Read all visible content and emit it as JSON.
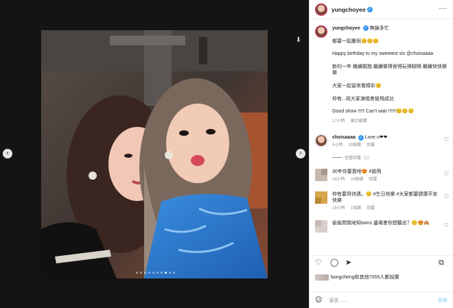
{
  "viewer": {
    "prev_icon": "chevron-left-icon",
    "next_icon": "chevron-right-icon",
    "download_icon": "download-icon",
    "prev_glyph": "‹",
    "next_glyph": "›",
    "download_glyph": "⬇"
  },
  "header": {
    "username": "yungchoyee",
    "more_glyph": "···"
  },
  "caption": {
    "username": "yungchoyee",
    "headline": "無論多忙",
    "lines": [
      "都要一起慶祝😊😊😊",
      "Happy birthday to my sweetest sis @choisaaaa",
      "新的一年 繼續靚抱 繼續做得食得玩得瞓得 繼續快快樂樂",
      "大家一起留來看精彩😊",
      "仲有...祝大家演唱會搶飛成功",
      "Good show !!!!! Can't wait !!!!!!😊😊😊"
    ],
    "time": "17小時",
    "translate": "顯示翻譯"
  },
  "comments": [
    {
      "username": "choisaaaa",
      "text": "Love u❤❤",
      "time": "5小時",
      "likes": "39個讚",
      "reply": "回覆",
      "view_replies": "查看回覆（1）"
    },
    {
      "text": "30年你要靠咁😍 #搶飛",
      "time": "16小時",
      "likes": "24個讚",
      "reply": "回覆"
    },
    {
      "text": "仲有要齊待遇，😊 #生日快樂 #大家都要健康平安快樂",
      "time": "16小時",
      "likes": "1個讚",
      "reply": "回覆"
    },
    {
      "text": "偷偷問我啱知twins 邊場會你想聽去？😊😍🙈",
      "time": "",
      "likes": "",
      "reply": ""
    }
  ],
  "actions": {
    "like_glyph": "♡",
    "comment_glyph": "◯",
    "share_glyph": "➤",
    "save_glyph": "⧉"
  },
  "likes_text": "bongcheng和其他7055人都說讚",
  "compose": {
    "emoji_glyph": "☺",
    "placeholder": "留言……",
    "post_label": "發佈"
  },
  "colors": {
    "verified": "#3897f0",
    "heart_red": "#ed4956",
    "link": "#00376b"
  }
}
